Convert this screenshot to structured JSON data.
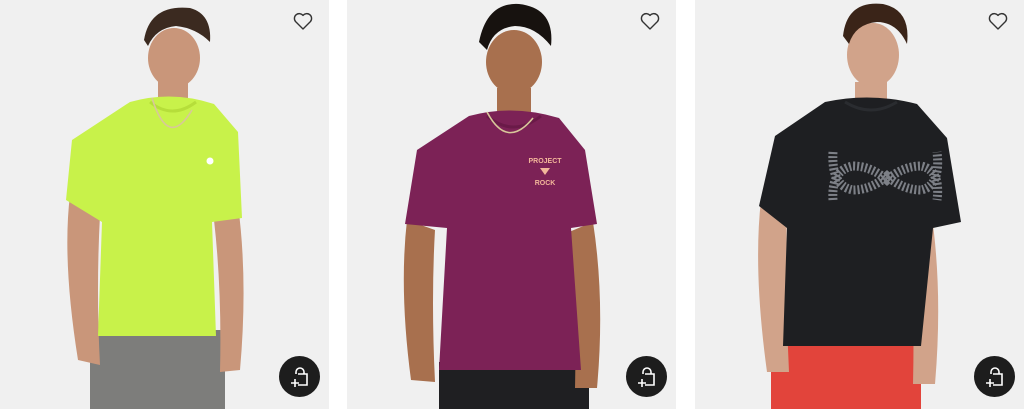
{
  "products": [
    {
      "shirt_color": "#c8f24a",
      "shirt_shade": "#b6de3a",
      "pants_color": "#7d7d7b",
      "skin_color": "#c9967a",
      "hair_color": "#3b2a20",
      "graphic": "small-logo"
    },
    {
      "shirt_color": "#7c2256",
      "shirt_shade": "#6a1a48",
      "pants_color": "#1f1f22",
      "skin_color": "#a8704e",
      "hair_color": "#17120f",
      "graphic_text_top": "PROJECT",
      "graphic_text_bottom": "ROCK",
      "graphic_color": "#f2b69a"
    },
    {
      "shirt_color": "#1e1f22",
      "shirt_shade": "#2a2c30",
      "pants_color": "#e2443b",
      "skin_color": "#d1a38a",
      "hair_color": "#3a2418",
      "graphic": "large-logo"
    }
  ],
  "icons": {
    "wishlist": "heart-icon",
    "quick_add": "bag-plus-icon"
  },
  "colors": {
    "card_background": "#f0f0f0",
    "quick_add_background": "#1d1d1d"
  }
}
